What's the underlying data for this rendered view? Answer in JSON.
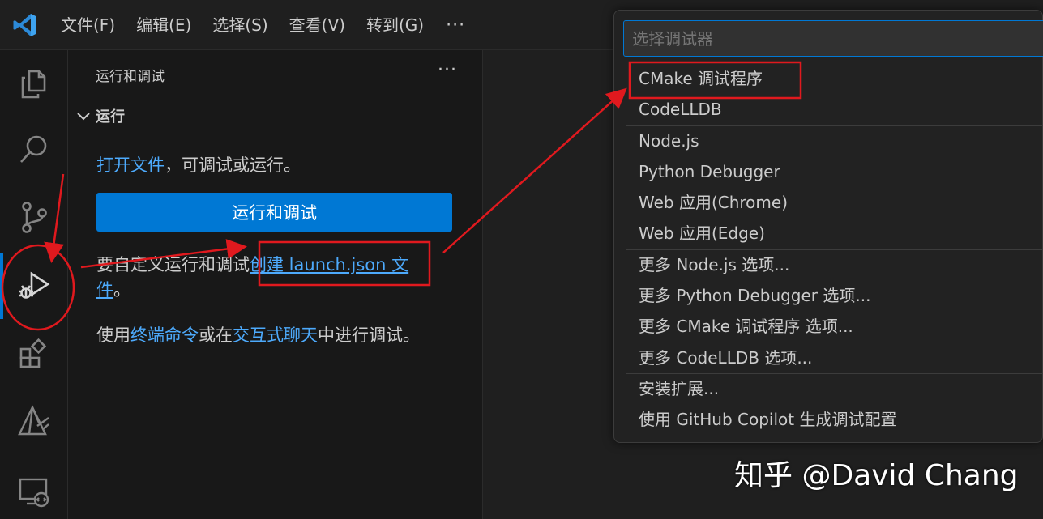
{
  "app": {
    "logo_icon": "vscode-logo-icon",
    "accent": "#0078d4",
    "link_color": "#4daafc"
  },
  "menu": {
    "items": [
      {
        "label": "文件(F)"
      },
      {
        "label": "编辑(E)"
      },
      {
        "label": "选择(S)"
      },
      {
        "label": "查看(V)"
      },
      {
        "label": "转到(G)"
      }
    ],
    "more": "···"
  },
  "activity_bar": {
    "icons": [
      "explorer-icon",
      "search-icon",
      "source-control-icon",
      "run-and-debug-icon",
      "extensions-icon",
      "cmake-icon",
      "remote-explorer-icon"
    ],
    "active": "run-and-debug-icon"
  },
  "sidebar": {
    "title": "运行和调试",
    "more": "···",
    "section_title": "运行",
    "open_file_link": "打开文件",
    "open_file_rest": "，可调试或运行。",
    "run_button": "运行和调试",
    "customize_prefix": "要自定义运行和调试",
    "create_link": "创建 launch.json 文件",
    "customize_suffix": "。",
    "use_prefix": "使用",
    "terminal_link": "终端命令",
    "or_text": "或在",
    "chat_link": "交互式聊天",
    "use_suffix": "中进行调试。"
  },
  "quick_pick": {
    "placeholder": "选择调试器",
    "items": [
      {
        "label": "CMake 调试程序"
      },
      {
        "label": "CodeLLDB"
      },
      {
        "label": "Node.js"
      },
      {
        "label": "Python Debugger"
      },
      {
        "label": "Web 应用(Chrome)"
      },
      {
        "label": "Web 应用(Edge)"
      },
      {
        "label": "更多 Node.js 选项..."
      },
      {
        "label": "更多 Python Debugger 选项..."
      },
      {
        "label": "更多 CMake 调试程序 选项..."
      },
      {
        "label": "更多 CodeLLDB 选项..."
      },
      {
        "label": "安装扩展..."
      },
      {
        "label": "使用 GitHub Copilot 生成调试配置"
      }
    ]
  },
  "watermark": "知乎 @David Chang",
  "annotation_color": "#e0191e"
}
